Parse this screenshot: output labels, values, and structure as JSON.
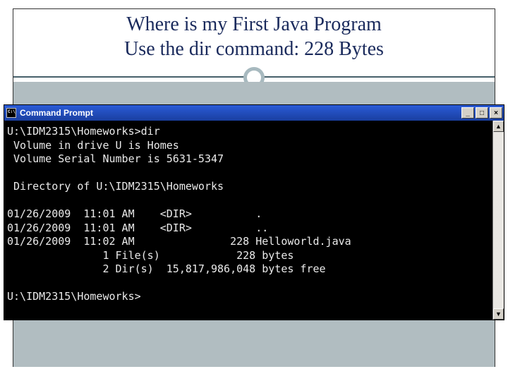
{
  "slide": {
    "title_line1": "Where is my First Java Program",
    "title_line2": "Use the dir command: 228 Bytes"
  },
  "cmd": {
    "window_title": "Command Prompt",
    "buttons": {
      "min": "_",
      "max": "□",
      "close": "×"
    },
    "output": "U:\\IDM2315\\Homeworks>dir\n Volume in drive U is Homes\n Volume Serial Number is 5631-5347\n\n Directory of U:\\IDM2315\\Homeworks\n\n01/26/2009  11:01 AM    <DIR>          .\n01/26/2009  11:01 AM    <DIR>          ..\n01/26/2009  11:02 AM               228 Helloworld.java\n               1 File(s)            228 bytes\n               2 Dir(s)  15,817,986,048 bytes free\n\nU:\\IDM2315\\Homeworks>"
  }
}
